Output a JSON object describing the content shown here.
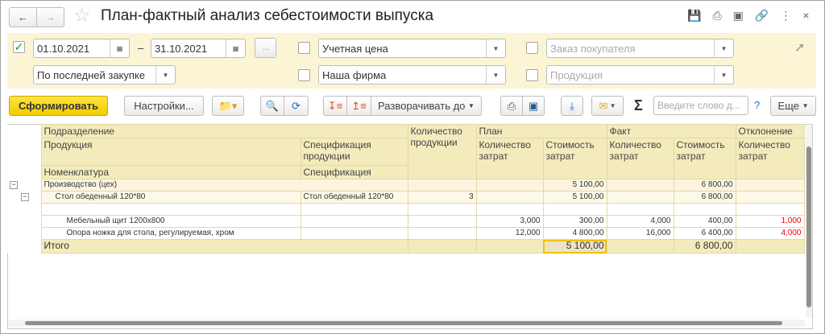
{
  "window": {
    "title": "План-фактный анализ себестоимости выпуска"
  },
  "filters": {
    "period_enabled": true,
    "date_from": "01.10.2021",
    "date_to": "31.10.2021",
    "dash": "–",
    "period_button": "...",
    "price_type": {
      "enabled": false,
      "value": "Учетная цена"
    },
    "customer_order": {
      "enabled": false,
      "placeholder": "Заказ покупателя"
    },
    "price_method": {
      "value": "По последней закупке"
    },
    "organization": {
      "enabled": false,
      "value": "Наша фирма"
    },
    "product": {
      "enabled": false,
      "placeholder": "Продукция"
    }
  },
  "toolbar": {
    "generate": "Сформировать",
    "settings": "Настройки...",
    "expand_to": "Разворачивать до",
    "search_placeholder": "Введите слово д...",
    "help": "?",
    "more": "Еще",
    "sigma": "Σ"
  },
  "colors": {
    "accent": "#f5d300",
    "header_bg": "#f4ebbd",
    "negative": "#e00000"
  },
  "table": {
    "headers": {
      "division": "Подразделение",
      "product": "Продукция",
      "product_spec": "Спецификация продукции",
      "product_qty": "Количество продукции",
      "plan": "План",
      "fact": "Факт",
      "deviation": "Отклонение",
      "cost_qty": "Количество затрат",
      "cost_value": "Стоимость затрат",
      "nomenclature": "Номенклатура",
      "spec": "Спецификация"
    },
    "rows": [
      {
        "level": 0,
        "cells": [
          "Производство (цех)",
          "",
          "",
          "",
          "5 100,00",
          "",
          "6 800,00",
          ""
        ]
      },
      {
        "level": 1,
        "cells": [
          "Стол обеденный 120*80",
          "Стол обеденный 120*80",
          "3",
          "",
          "5 100,00",
          "",
          "6 800,00",
          ""
        ]
      },
      {
        "level": 2,
        "cells": [
          "",
          "",
          "",
          "",
          "",
          "",
          "",
          ""
        ]
      },
      {
        "level": 2,
        "cells": [
          "Мебельный щит 1200х800",
          "",
          "",
          "3,000",
          "300,00",
          "4,000",
          "400,00",
          "1,000"
        ]
      },
      {
        "level": 2,
        "cells": [
          "Опора ножка для стола, регулируемая, хром",
          "",
          "",
          "12,000",
          "4 800,00",
          "16,000",
          "6 400,00",
          "4,000"
        ]
      }
    ],
    "total": {
      "label": "Итого",
      "plan_cost": "5 100,00",
      "fact_cost": "6 800,00"
    }
  }
}
